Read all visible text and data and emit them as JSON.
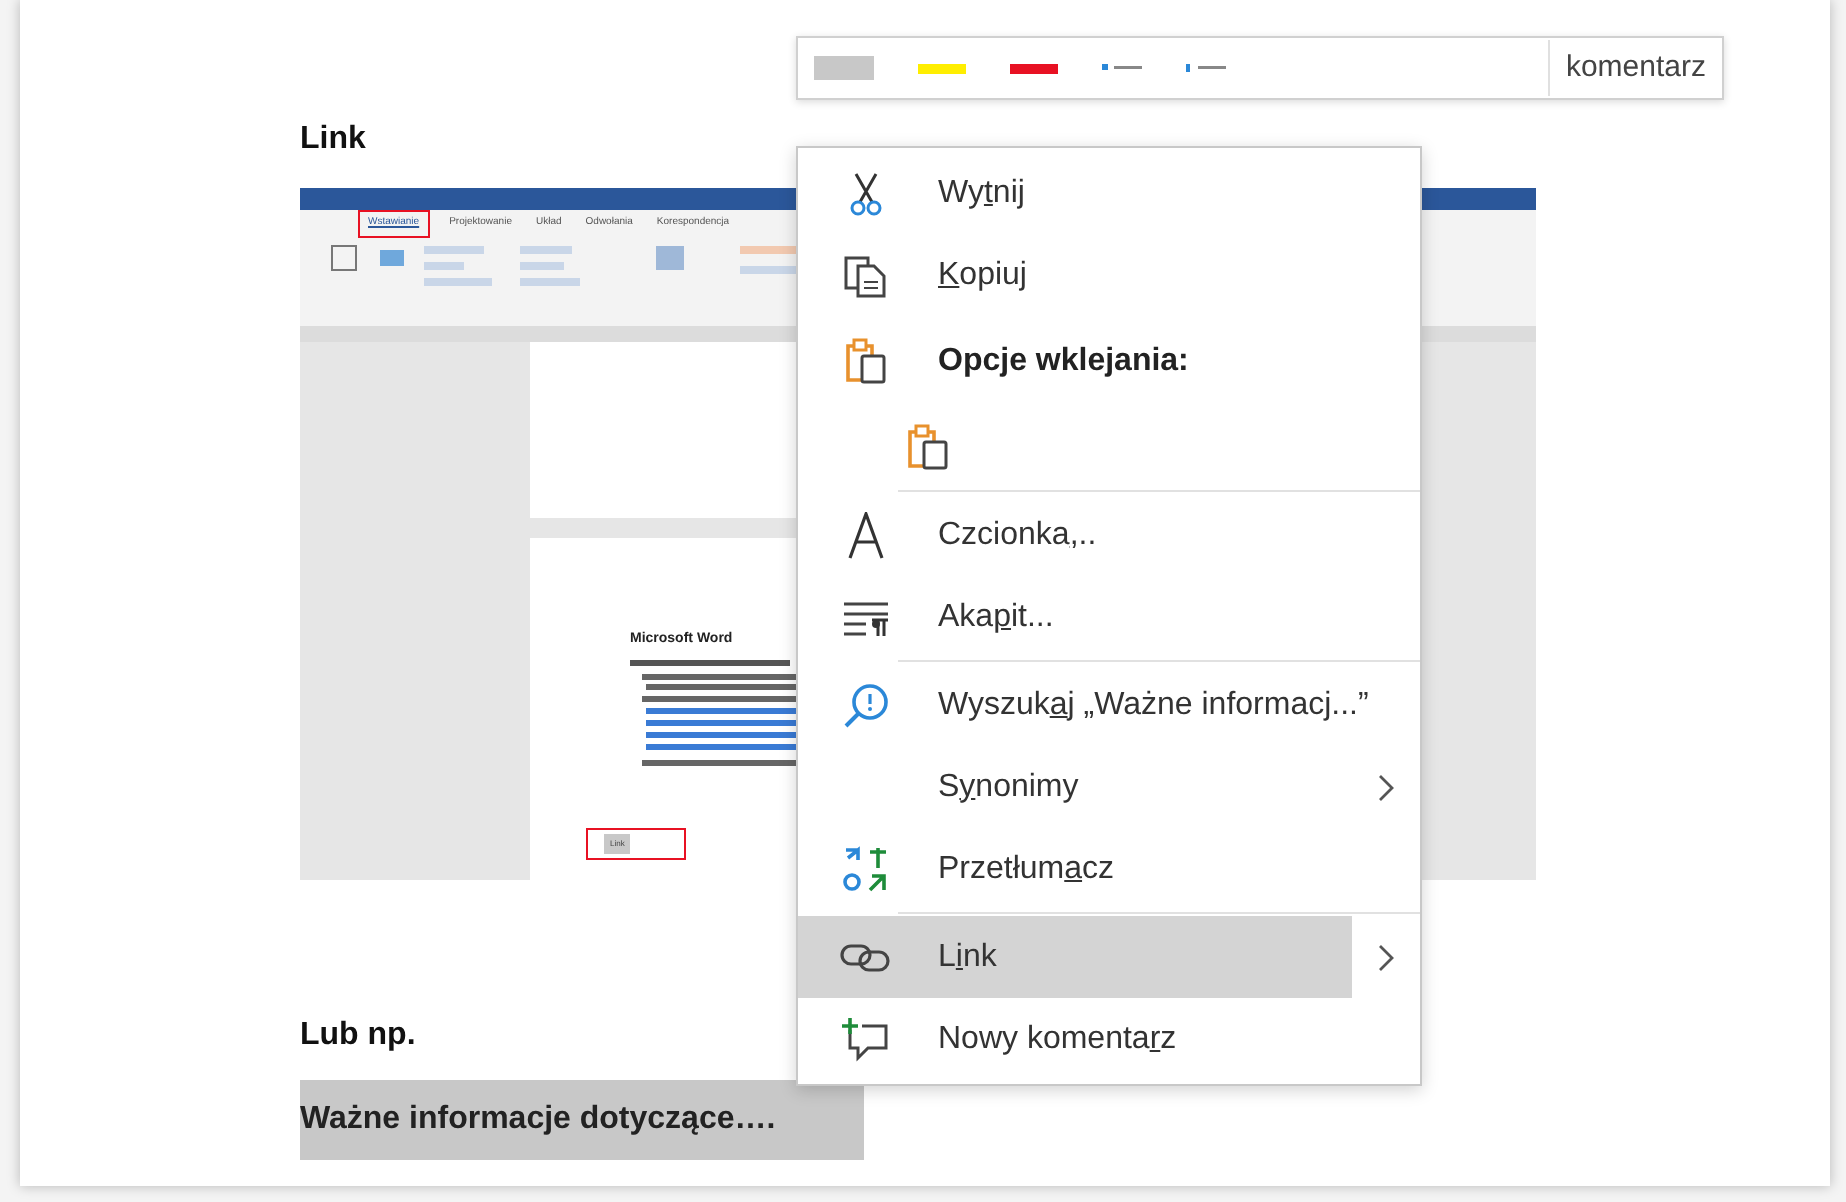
{
  "toolbar": {
    "swatches": [
      {
        "color": "#c8c8c8"
      },
      {
        "color": "#ffee00"
      },
      {
        "color": "#e81123"
      }
    ],
    "comment": "komentarz"
  },
  "heading": "Link",
  "screenshot": {
    "tabs": [
      {
        "label": "Wstawianie",
        "selected": true
      },
      {
        "label": "Projektowanie",
        "selected": false
      },
      {
        "label": "Układ",
        "selected": false
      },
      {
        "label": "Odwołania",
        "selected": false
      },
      {
        "label": "Korespondencja",
        "selected": false
      }
    ],
    "doc_title": "Microsoft Word",
    "button": "Link"
  },
  "heading2": "Lub np.",
  "highlighted": "Ważne informacje dotyczące….",
  "menu": [
    {
      "kind": "item",
      "pre": "Wy",
      "key": "t",
      "post": "nij",
      "selected": false
    },
    {
      "kind": "item",
      "key": "K",
      "post": "opiuj",
      "selected": false
    },
    {
      "kind": "header",
      "label": "Opcje wklejania:"
    },
    {
      "kind": "paste"
    },
    {
      "kind": "separator"
    },
    {
      "kind": "item",
      "pre": "Czcionka",
      "key": ",",
      "post": "..",
      "selected": false
    },
    {
      "kind": "item",
      "pre": "Aka",
      "key": "p",
      "post": "it...",
      "selected": false
    },
    {
      "kind": "separator"
    },
    {
      "kind": "item",
      "pre": "Wyszuk",
      "key": "a",
      "post": "j „Ważne informacj...”",
      "selected": false
    },
    {
      "kind": "submenu",
      "pre": "S",
      "key": "y",
      "post": "nonimy",
      "selected": false
    },
    {
      "kind": "item",
      "pre": "Przetłum",
      "key": "a",
      "post": "cz",
      "selected": false
    },
    {
      "kind": "separator"
    },
    {
      "kind": "submenu",
      "pre": "L",
      "key": "i",
      "post": "nk",
      "selected": true
    },
    {
      "kind": "item",
      "pre": "Nowy komenta",
      "key": "r",
      "post": "z",
      "selected": false
    }
  ]
}
